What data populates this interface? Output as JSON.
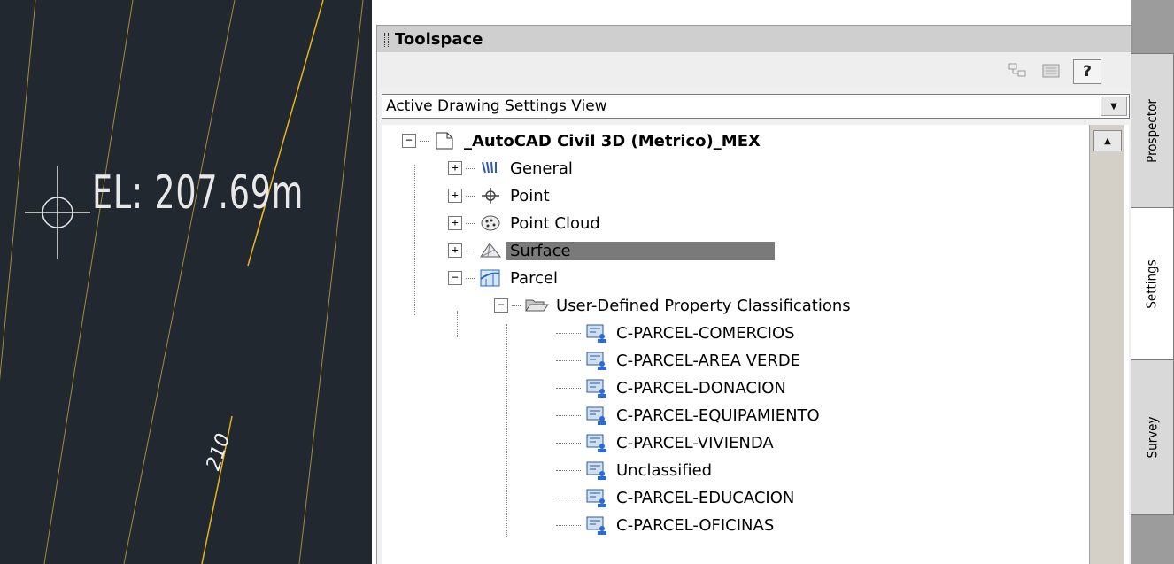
{
  "cad": {
    "elevation_label": "EL: 207.69m",
    "contour_label": "210"
  },
  "toolspace": {
    "title": "Toolspace",
    "help_label": "?",
    "view_select": {
      "value": "Active Drawing Settings View"
    },
    "tree": {
      "root": {
        "label": "_AutoCAD Civil 3D (Metrico)_MEX",
        "icon": "drawing-icon"
      },
      "items": [
        {
          "label": "General",
          "icon": "general-settings-icon"
        },
        {
          "label": "Point",
          "icon": "point-icon"
        },
        {
          "label": "Point Cloud",
          "icon": "point-cloud-icon"
        },
        {
          "label": "Surface",
          "icon": "surface-icon",
          "selected": true
        },
        {
          "label": "Parcel",
          "icon": "parcel-icon",
          "expanded": true
        }
      ],
      "folder": {
        "label": "User-Defined Property Classifications",
        "icon": "folder-open-icon"
      },
      "classifications": [
        "C-PARCEL-COMERCIOS",
        "C-PARCEL-AREA VERDE",
        "C-PARCEL-DONACION",
        "C-PARCEL-EQUIPAMIENTO",
        "C-PARCEL-VIVIENDA",
        "Unclassified",
        "C-PARCEL-EDUCACION",
        "C-PARCEL-OFICINAS"
      ]
    },
    "tabs": [
      {
        "label": "Prospector"
      },
      {
        "label": "Settings",
        "active": true
      },
      {
        "label": "Survey"
      }
    ]
  },
  "colors": {
    "cad_background": "#212830",
    "contour_major": "#e6b21e",
    "contour_minor": "#b89a40",
    "selection": "#7a7a7a"
  }
}
